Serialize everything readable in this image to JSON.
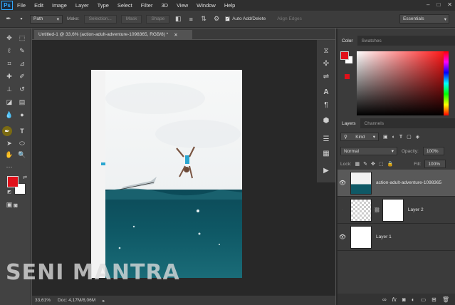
{
  "app": {
    "logo": "Ps"
  },
  "menu": [
    "File",
    "Edit",
    "Image",
    "Layer",
    "Type",
    "Select",
    "Filter",
    "3D",
    "View",
    "Window",
    "Help"
  ],
  "options": {
    "mode": "Path",
    "make_label": "Make:",
    "selection_btn": "Selection...",
    "mask_btn": "Mask",
    "shape_btn": "Shape",
    "auto_add_delete": "Auto Add/Delete",
    "align_edges": "Align Edges",
    "workspace": "Essentials"
  },
  "document": {
    "tab_title": "Untitled-1 @ 33,6% (action-adult-adventure-1098365, RGB/8) *"
  },
  "status": {
    "zoom": "33,61%",
    "doc": "Doc: 4,17M/8,06M"
  },
  "watermark": "SENI MANTRA",
  "colors": {
    "foreground": "#e0101a",
    "background": "#ffffff",
    "accent": "#31a8ff"
  },
  "color_panel": {
    "tabs": [
      "Color",
      "Swatches"
    ]
  },
  "layers_panel": {
    "tabs": [
      "Layers",
      "Channels"
    ],
    "filter": "Kind",
    "blend_mode": "Normal",
    "opacity_label": "Opacity:",
    "opacity": "100%",
    "lock_label": "Lock:",
    "fill_label": "Fill:",
    "fill": "100%",
    "layers": [
      {
        "name": "action-adult-adventure-1098365",
        "visible": true,
        "selected": true
      },
      {
        "name": "Layer 2",
        "visible": false,
        "selected": false
      },
      {
        "name": "Layer 1",
        "visible": true,
        "selected": false
      }
    ],
    "footer_icons": [
      "link-icon",
      "fx-icon",
      "mask-icon",
      "adjustment-icon",
      "group-icon",
      "new-layer-icon",
      "trash-icon"
    ]
  }
}
